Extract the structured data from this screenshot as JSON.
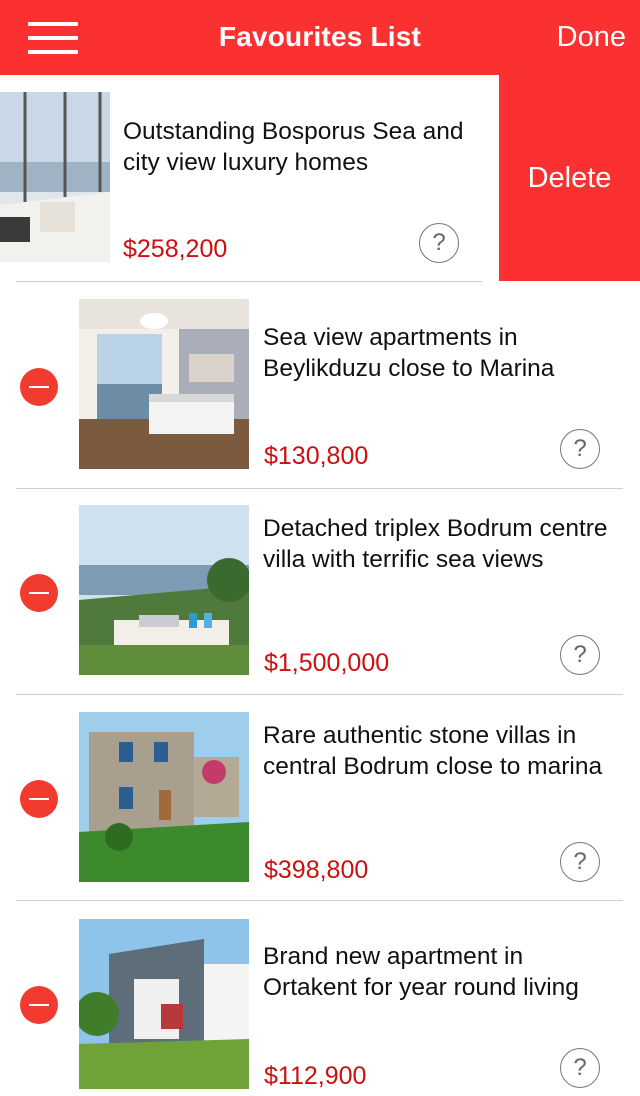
{
  "navbar": {
    "title": "Favourites List",
    "done_label": "Done",
    "menu_icon": "hamburger-menu-icon",
    "background_color": "#fb3131"
  },
  "swiped_item": {
    "title": "Outstanding Bosporus Sea and city view luxury homes",
    "price": "$258,200",
    "delete_label": "Delete",
    "help_icon": "?"
  },
  "listings": [
    {
      "title": "Sea view apartments in Beylikduzu close to Marina",
      "price": "$130,800",
      "help_icon": "?"
    },
    {
      "title": "Detached triplex Bodrum centre villa with terrific sea views",
      "price": "$1,500,000",
      "help_icon": "?"
    },
    {
      "title": "Rare authentic stone villas in central Bodrum close to marina",
      "price": "$398,800",
      "help_icon": "?"
    },
    {
      "title": "Brand new apartment in Ortakent for year round living",
      "price": "$112,900",
      "help_icon": "?"
    }
  ],
  "colors": {
    "accent": "#fb3131",
    "price": "#cc0f0f",
    "delete_control": "#f23b2f"
  }
}
